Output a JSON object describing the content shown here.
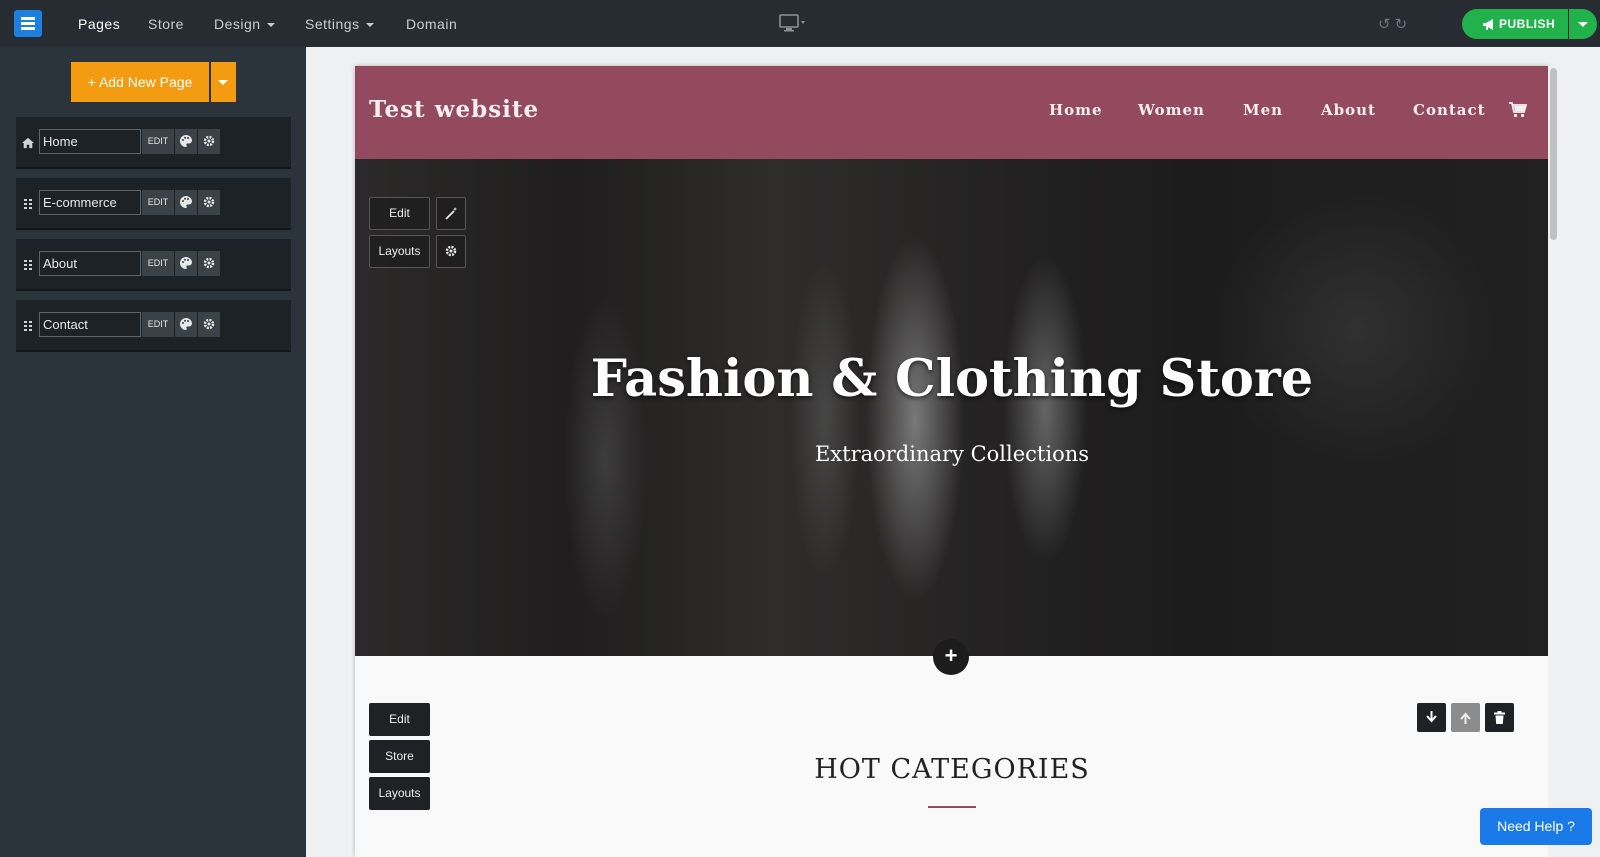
{
  "topbar": {
    "nav": [
      {
        "label": "Pages"
      },
      {
        "label": "Store"
      },
      {
        "label": "Design"
      },
      {
        "label": "Settings"
      },
      {
        "label": "Domain"
      }
    ],
    "publish_label": "PUBLISH"
  },
  "sidebar": {
    "add_page_label": "+ Add New Page",
    "pages": [
      {
        "name": "Home",
        "edit_label": "EDIT"
      },
      {
        "name": "E-commerce",
        "edit_label": "EDIT"
      },
      {
        "name": "About",
        "edit_label": "EDIT"
      },
      {
        "name": "Contact",
        "edit_label": "EDIT"
      }
    ]
  },
  "site": {
    "title": "Test website",
    "nav": [
      "Home",
      "Women",
      "Men",
      "About",
      "Contact"
    ],
    "hero": {
      "title": "Fashion & Clothing Store",
      "subtitle": "Extraordinary Collections",
      "edit_label": "Edit",
      "layouts_label": "Layouts"
    },
    "section": {
      "edit_label": "Edit",
      "store_label": "Store",
      "layouts_label": "Layouts",
      "heading": "HOT CATEGORIES"
    }
  },
  "help_label": "Need Help ?",
  "colors": {
    "brand_header": "#934a5f",
    "publish": "#22b24c",
    "add_page": "#f39c11",
    "help": "#1a7be8"
  }
}
